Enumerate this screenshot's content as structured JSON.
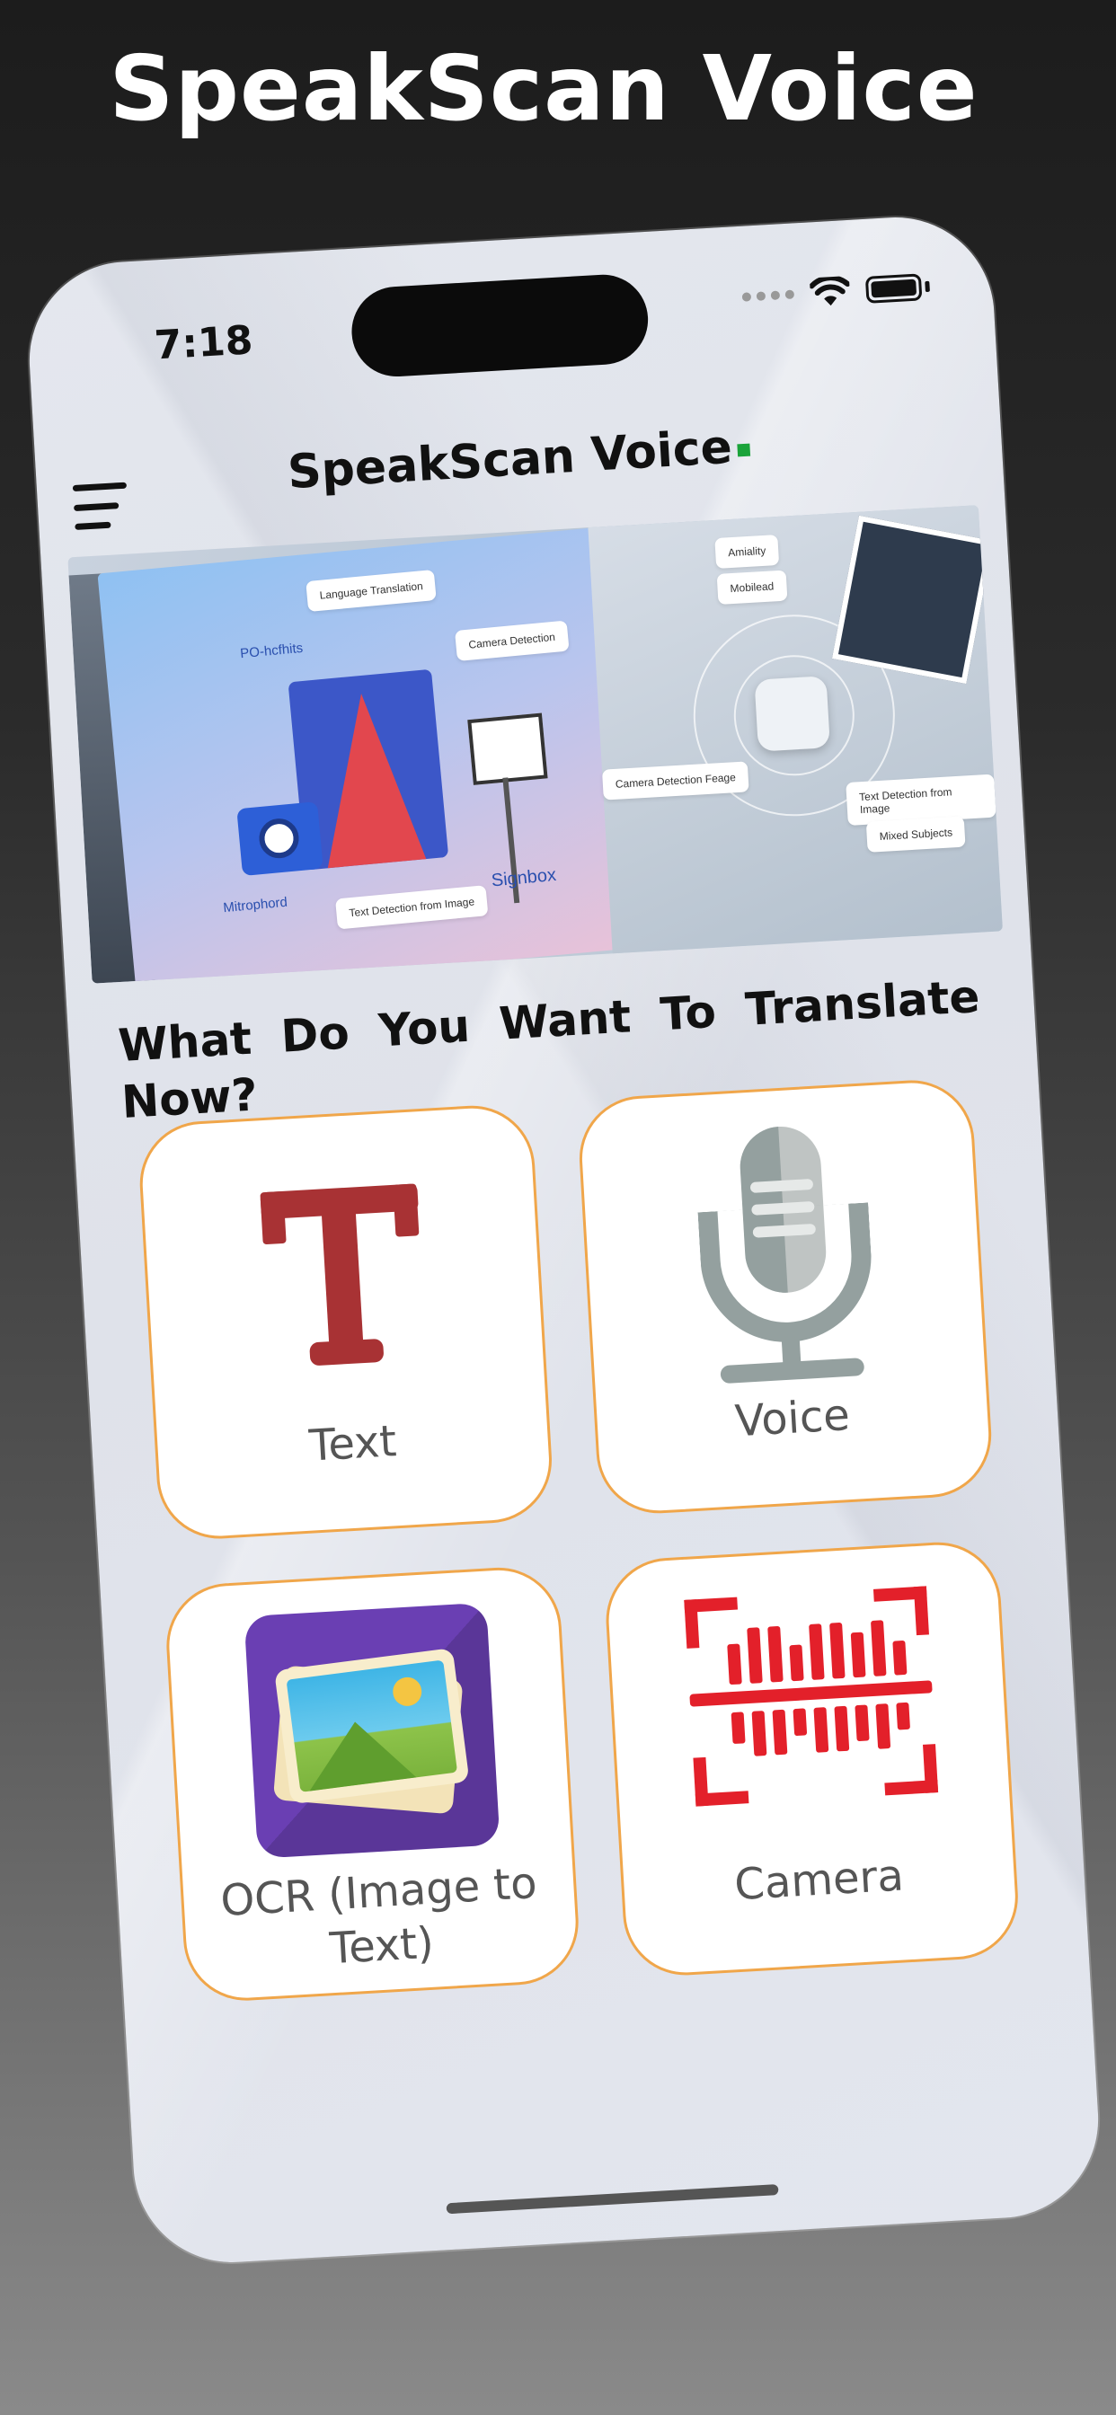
{
  "promo": {
    "title": "SpeakScan Voice"
  },
  "status_bar": {
    "time": "7:18",
    "icons": [
      "signal-dots-icon",
      "wifi-icon",
      "battery-icon"
    ]
  },
  "header": {
    "title": "SpeakScan Voice",
    "menu_icon": "hamburger-menu-icon"
  },
  "banner": {
    "labels": {
      "language_translation": "Language Translation",
      "camera_detection": "Camera Detection",
      "mitrophord": "Mitrophord",
      "signbox": "Signbox",
      "text_detection_left": "Text Detection from Image",
      "camera_detection_page": "Camera Detection Feage",
      "text_detection_right": "Text Detection from Image",
      "mixed_subjects": "Mixed Subjects",
      "po_text": "PO-hcfhits",
      "amility": "Amiality",
      "mobilead": "Mobilead"
    }
  },
  "question": "What Do You Want To Translate Now?",
  "tiles": [
    {
      "id": "text",
      "label": "Text",
      "icon": "letter-t-icon"
    },
    {
      "id": "voice",
      "label": "Voice",
      "icon": "microphone-icon"
    },
    {
      "id": "ocr",
      "label": "OCR (Image to Text)",
      "icon": "image-gallery-icon"
    },
    {
      "id": "camera",
      "label": "Camera",
      "icon": "barcode-scan-icon"
    }
  ],
  "colors": {
    "tile_border": "#f0a64a",
    "text_icon": "#a83234",
    "mic_icon": "#94a09f",
    "ocr_icon_bg": "#6a3fb3",
    "scan_icon": "#e3202a",
    "title_dot": "#1aa33a"
  }
}
